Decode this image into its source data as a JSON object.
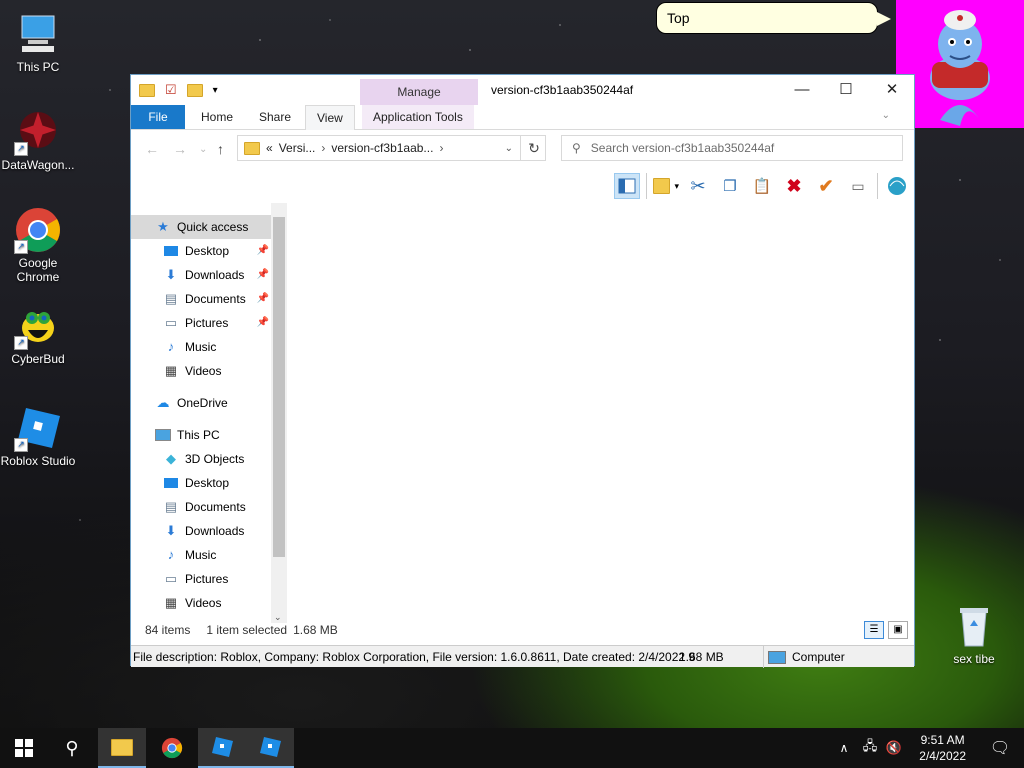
{
  "desktop": {
    "icons": [
      {
        "label": "This PC"
      },
      {
        "label": "DataWagon..."
      },
      {
        "label": "Google Chrome"
      },
      {
        "label": "CyberBud"
      },
      {
        "label": "Roblox Studio"
      },
      {
        "label": "sex tibe"
      }
    ]
  },
  "bubble": {
    "text": "Top"
  },
  "window": {
    "title": "version-cf3b1aab350244af",
    "manage_tab": "Manage",
    "ribbon_tabs": [
      "File",
      "Home",
      "Share",
      "View",
      "Application Tools"
    ],
    "address": {
      "prefix": "«",
      "crumb1": "Versi...",
      "crumb2": "version-cf3b1aab..."
    },
    "search_placeholder": "Search version-cf3b1aab350244af",
    "nav": {
      "quick_access": "Quick access",
      "quick_items": [
        "Desktop",
        "Downloads",
        "Documents",
        "Pictures",
        "Music",
        "Videos"
      ],
      "onedrive": "OneDrive",
      "this_pc": "This PC",
      "pc_items": [
        "3D Objects",
        "Desktop",
        "Documents",
        "Downloads",
        "Music",
        "Pictures",
        "Videos"
      ]
    },
    "status": {
      "items": "84 items",
      "selected": "1 item selected",
      "size": "1.68 MB"
    },
    "description": {
      "text": "File description: Roblox, Company: Roblox Corporation, File version: 1.6.0.8611, Date created: 2/4/2022 9",
      "size": "1.68 MB",
      "location": "Computer"
    }
  },
  "taskbar": {
    "time": "9:51 AM",
    "date": "2/4/2022"
  },
  "colors": {
    "file_tab": "#1979ca",
    "manage_tab": "#e8d4ef",
    "genie_bg": "#ff00ff"
  }
}
